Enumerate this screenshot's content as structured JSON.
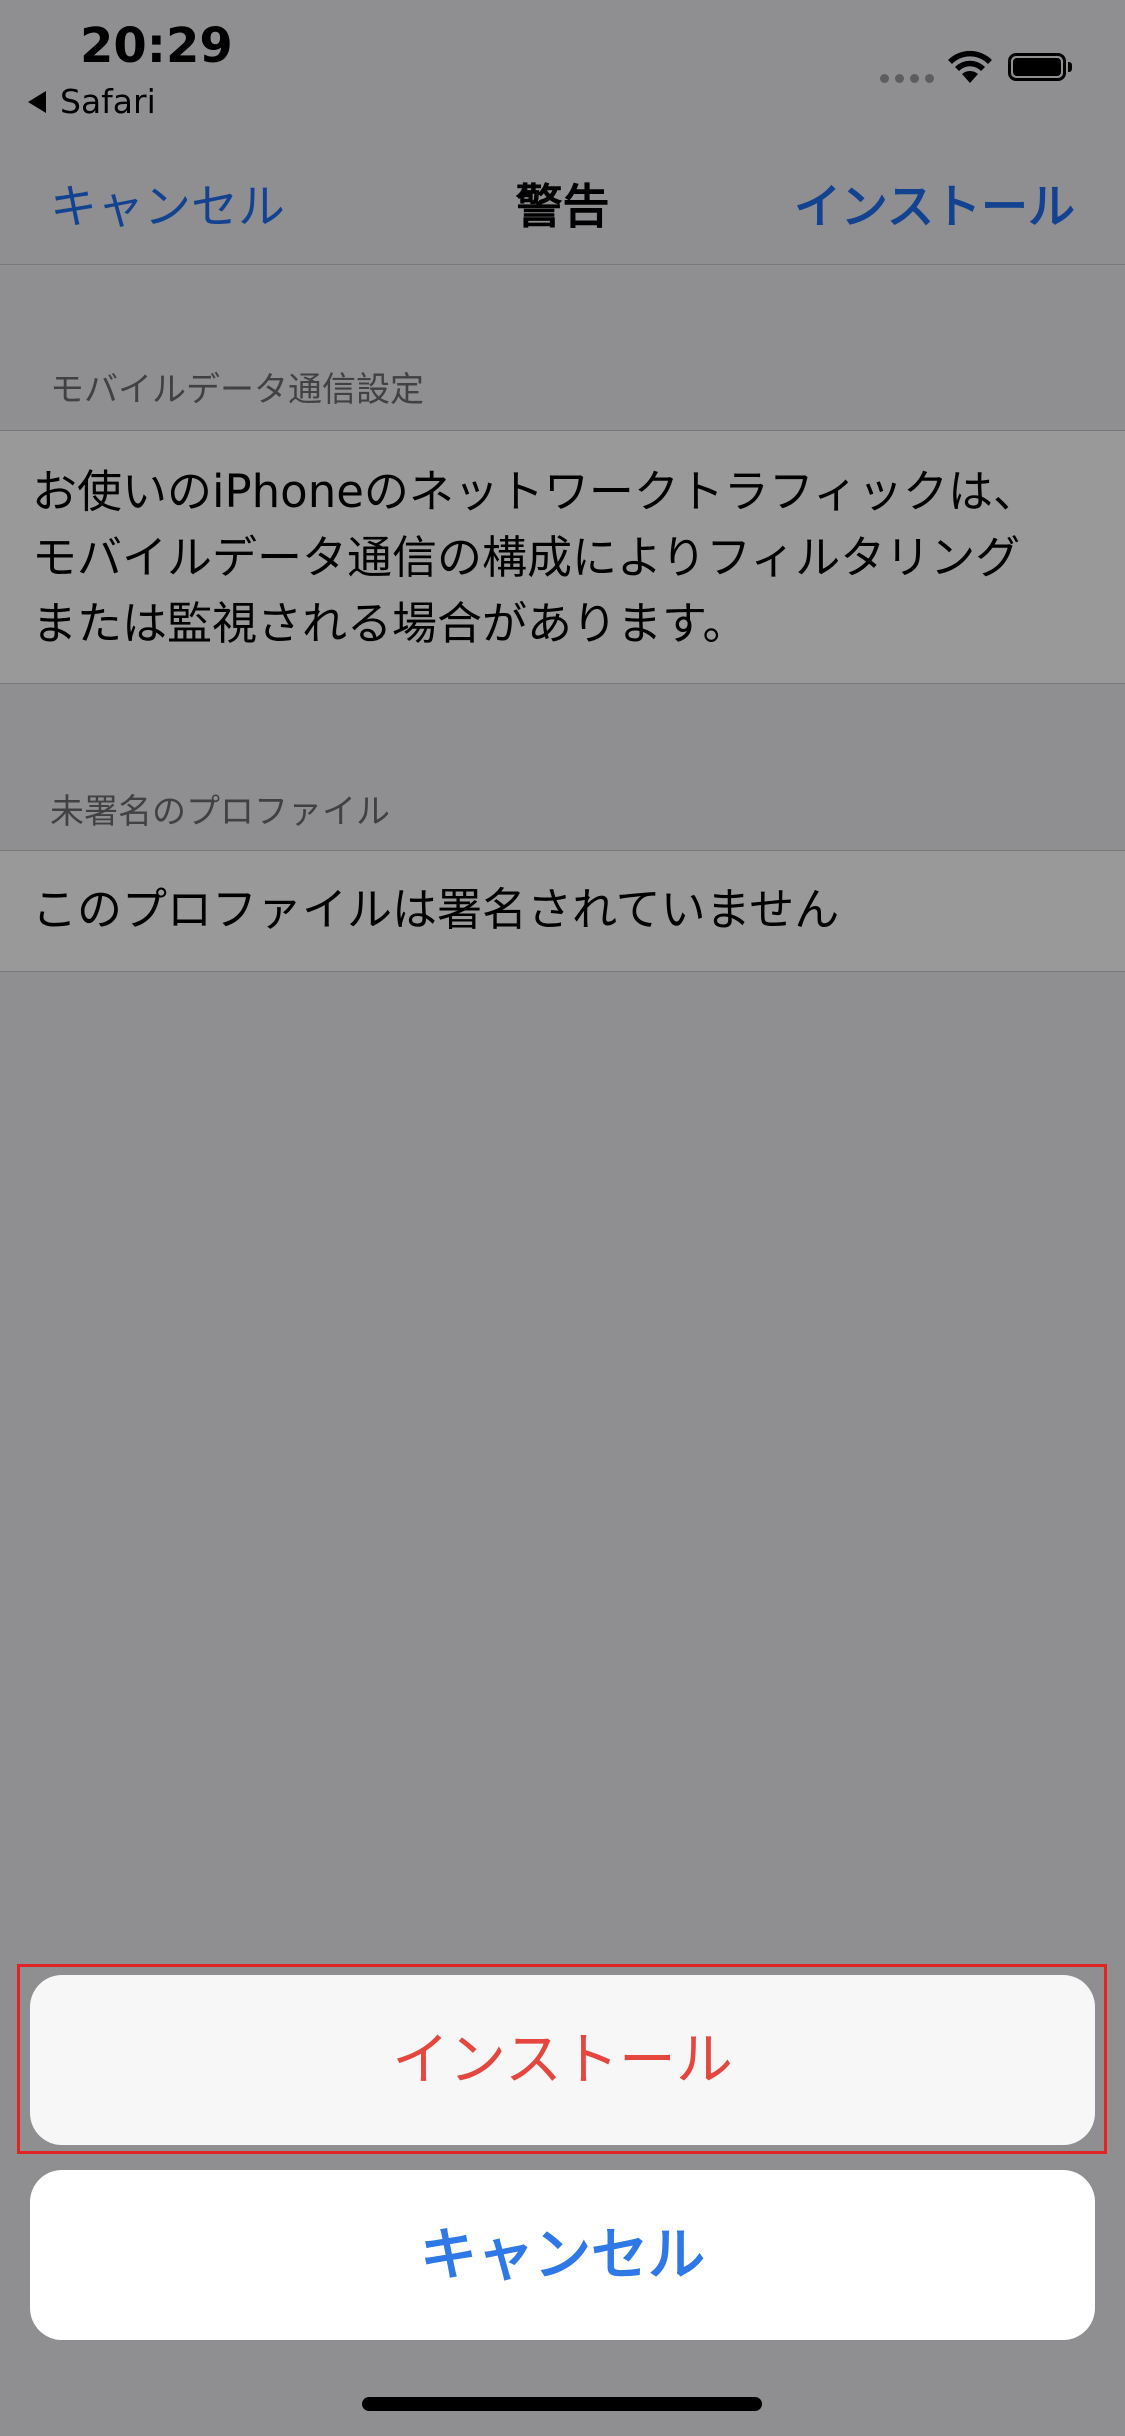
{
  "status_bar": {
    "time": "20:29",
    "back_app": "Safari"
  },
  "nav": {
    "cancel_label": "キャンセル",
    "title": "警告",
    "install_label": "インストール"
  },
  "sections": [
    {
      "header": "モバイルデータ通信設定",
      "lines": [
        "お使いのiPhoneのネットワークトラフィックは、",
        "モバイルデータ通信の構成によりフィルタリング",
        "または監視される場合があります。"
      ]
    },
    {
      "header": "未署名のプロファイル",
      "body": "このプロファイルは署名されていません"
    }
  ],
  "action_sheet": {
    "install_label": "インストール",
    "cancel_label": "キャンセル"
  },
  "colors": {
    "link_blue": "#1e6ff0",
    "destructive_red": "#e5463d",
    "highlight_red": "#e02424"
  }
}
